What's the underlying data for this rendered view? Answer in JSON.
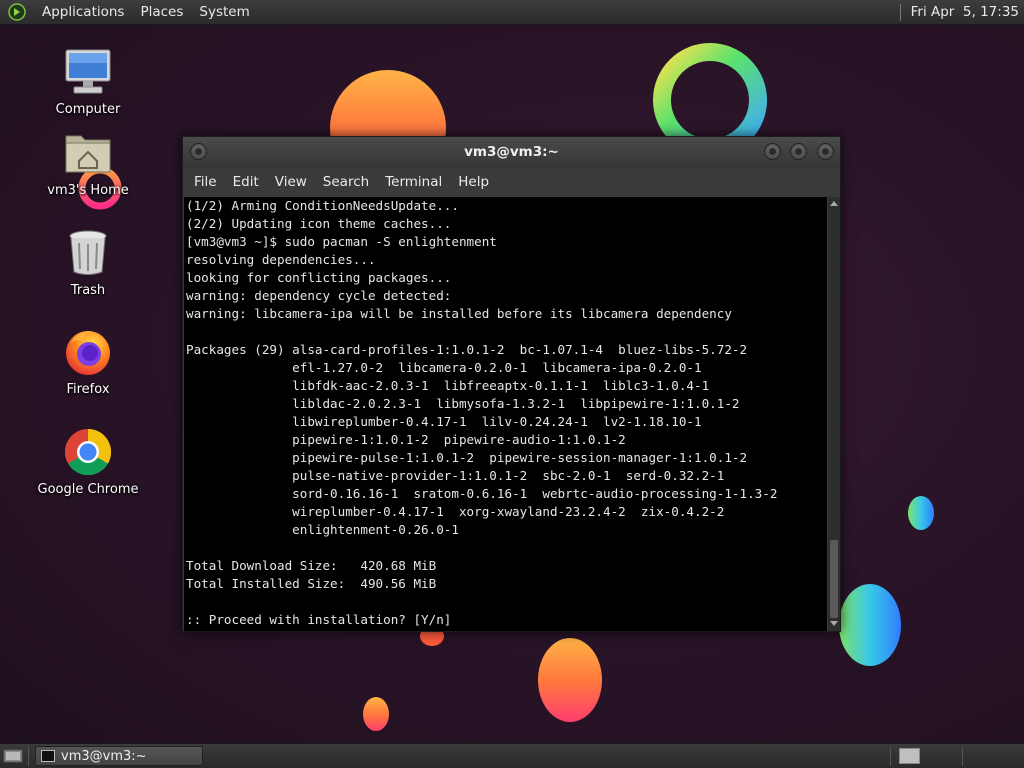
{
  "top_panel": {
    "menus": [
      "Applications",
      "Places",
      "System"
    ],
    "clock": "Fri Apr  5, 17:35"
  },
  "desktop": {
    "icons": [
      {
        "label": "Computer",
        "icon": "computer-icon"
      },
      {
        "label": "vm3's Home",
        "icon": "home-folder-icon"
      },
      {
        "label": "Trash",
        "icon": "trash-icon"
      },
      {
        "label": "Firefox",
        "icon": "firefox-icon"
      },
      {
        "label": "Google Chrome",
        "icon": "chrome-icon"
      }
    ]
  },
  "terminal": {
    "title": "vm3@vm3:~",
    "menu": [
      "File",
      "Edit",
      "View",
      "Search",
      "Terminal",
      "Help"
    ],
    "lines": [
      "(1/2) Arming ConditionNeedsUpdate...",
      "(2/2) Updating icon theme caches...",
      "[vm3@vm3 ~]$ sudo pacman -S enlightenment",
      "resolving dependencies...",
      "looking for conflicting packages...",
      "warning: dependency cycle detected:",
      "warning: libcamera-ipa will be installed before its libcamera dependency",
      "",
      "Packages (29) alsa-card-profiles-1:1.0.1-2  bc-1.07.1-4  bluez-libs-5.72-2",
      "              efl-1.27.0-2  libcamera-0.2.0-1  libcamera-ipa-0.2.0-1",
      "              libfdk-aac-2.0.3-1  libfreeaptx-0.1.1-1  liblc3-1.0.4-1",
      "              libldac-2.0.2.3-1  libmysofa-1.3.2-1  libpipewire-1:1.0.1-2",
      "              libwireplumber-0.4.17-1  lilv-0.24.24-1  lv2-1.18.10-1",
      "              pipewire-1:1.0.1-2  pipewire-audio-1:1.0.1-2",
      "              pipewire-pulse-1:1.0.1-2  pipewire-session-manager-1:1.0.1-2",
      "              pulse-native-provider-1:1.0.1-2  sbc-2.0-1  serd-0.32.2-1",
      "              sord-0.16.16-1  sratom-0.6.16-1  webrtc-audio-processing-1-1.3-2",
      "              wireplumber-0.4.17-1  xorg-xwayland-23.2.4-2  zix-0.4.2-2",
      "              enlightenment-0.26.0-1",
      "",
      "Total Download Size:   420.68 MiB",
      "Total Installed Size:  490.56 MiB",
      "",
      ":: Proceed with installation? [Y/n]"
    ]
  },
  "taskbar": {
    "task_label": "vm3@vm3:~"
  },
  "colors": {
    "wallpaper": "#2a1428",
    "panel": "#333333",
    "terminal_bg": "#000000",
    "terminal_fg": "#e6e6e6"
  }
}
